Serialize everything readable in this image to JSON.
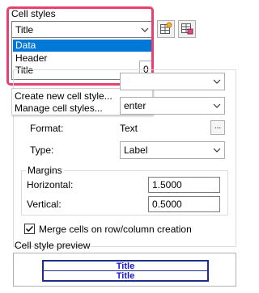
{
  "cell_styles": {
    "label": "Cell styles",
    "selected": "Title",
    "options": [
      "Data",
      "Header",
      "Title"
    ],
    "highlighted_option": "Data",
    "partial_value": "0"
  },
  "menu": {
    "create": "Create new cell style...",
    "manage": "Manage cell styles..."
  },
  "properties": {
    "partial_combo_value": "enter",
    "format_label": "Format:",
    "format_value": "Text",
    "format_button": "...",
    "type_label": "Type:",
    "type_value": "Label"
  },
  "margins": {
    "label": "Margins",
    "horizontal_label": "Horizontal:",
    "horizontal_value": "1.5000",
    "vertical_label": "Vertical:",
    "vertical_value": "0.5000"
  },
  "merge": {
    "label": "Merge cells on row/column creation",
    "checked": true
  },
  "preview": {
    "label": "Cell style preview",
    "row1": "Title",
    "row2": "Title"
  },
  "colors": {
    "highlight": "#e8416b",
    "selection": "#0078d7",
    "preview_text": "#1616e0"
  }
}
